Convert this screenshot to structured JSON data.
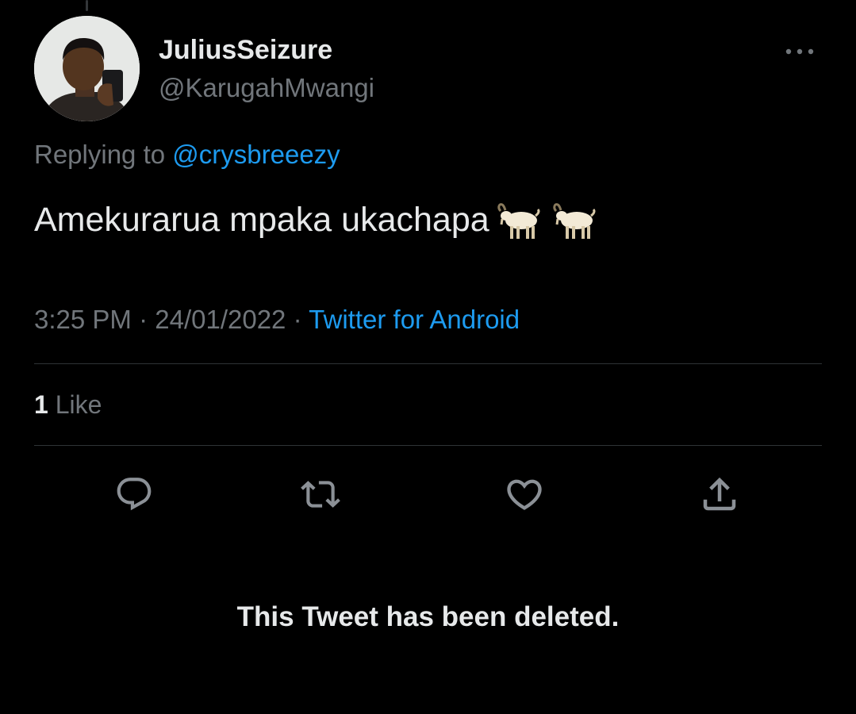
{
  "author": {
    "display_name": "JuliusSeizure",
    "handle": "@KarugahMwangi"
  },
  "reply": {
    "prefix": "Replying to",
    "mention": "@crysbreeezy"
  },
  "tweet": {
    "text": "Amekurarua mpaka ukachapa",
    "emoji": [
      "goat-emoji",
      "goat-emoji"
    ],
    "time": "3:25 PM",
    "date": "24/01/2022",
    "separator": "·",
    "source": "Twitter for Android"
  },
  "stats": {
    "like_count": "1",
    "like_label": "Like"
  },
  "actions": [
    "reply-icon",
    "retweet-icon",
    "like-icon",
    "share-icon"
  ],
  "deleted_notice": "This Tweet has been deleted.",
  "colors": {
    "background": "#000000",
    "primary_text": "#e7e9ea",
    "secondary_text": "#71767b",
    "accent": "#1d9bf0",
    "divider": "#2f3336"
  }
}
